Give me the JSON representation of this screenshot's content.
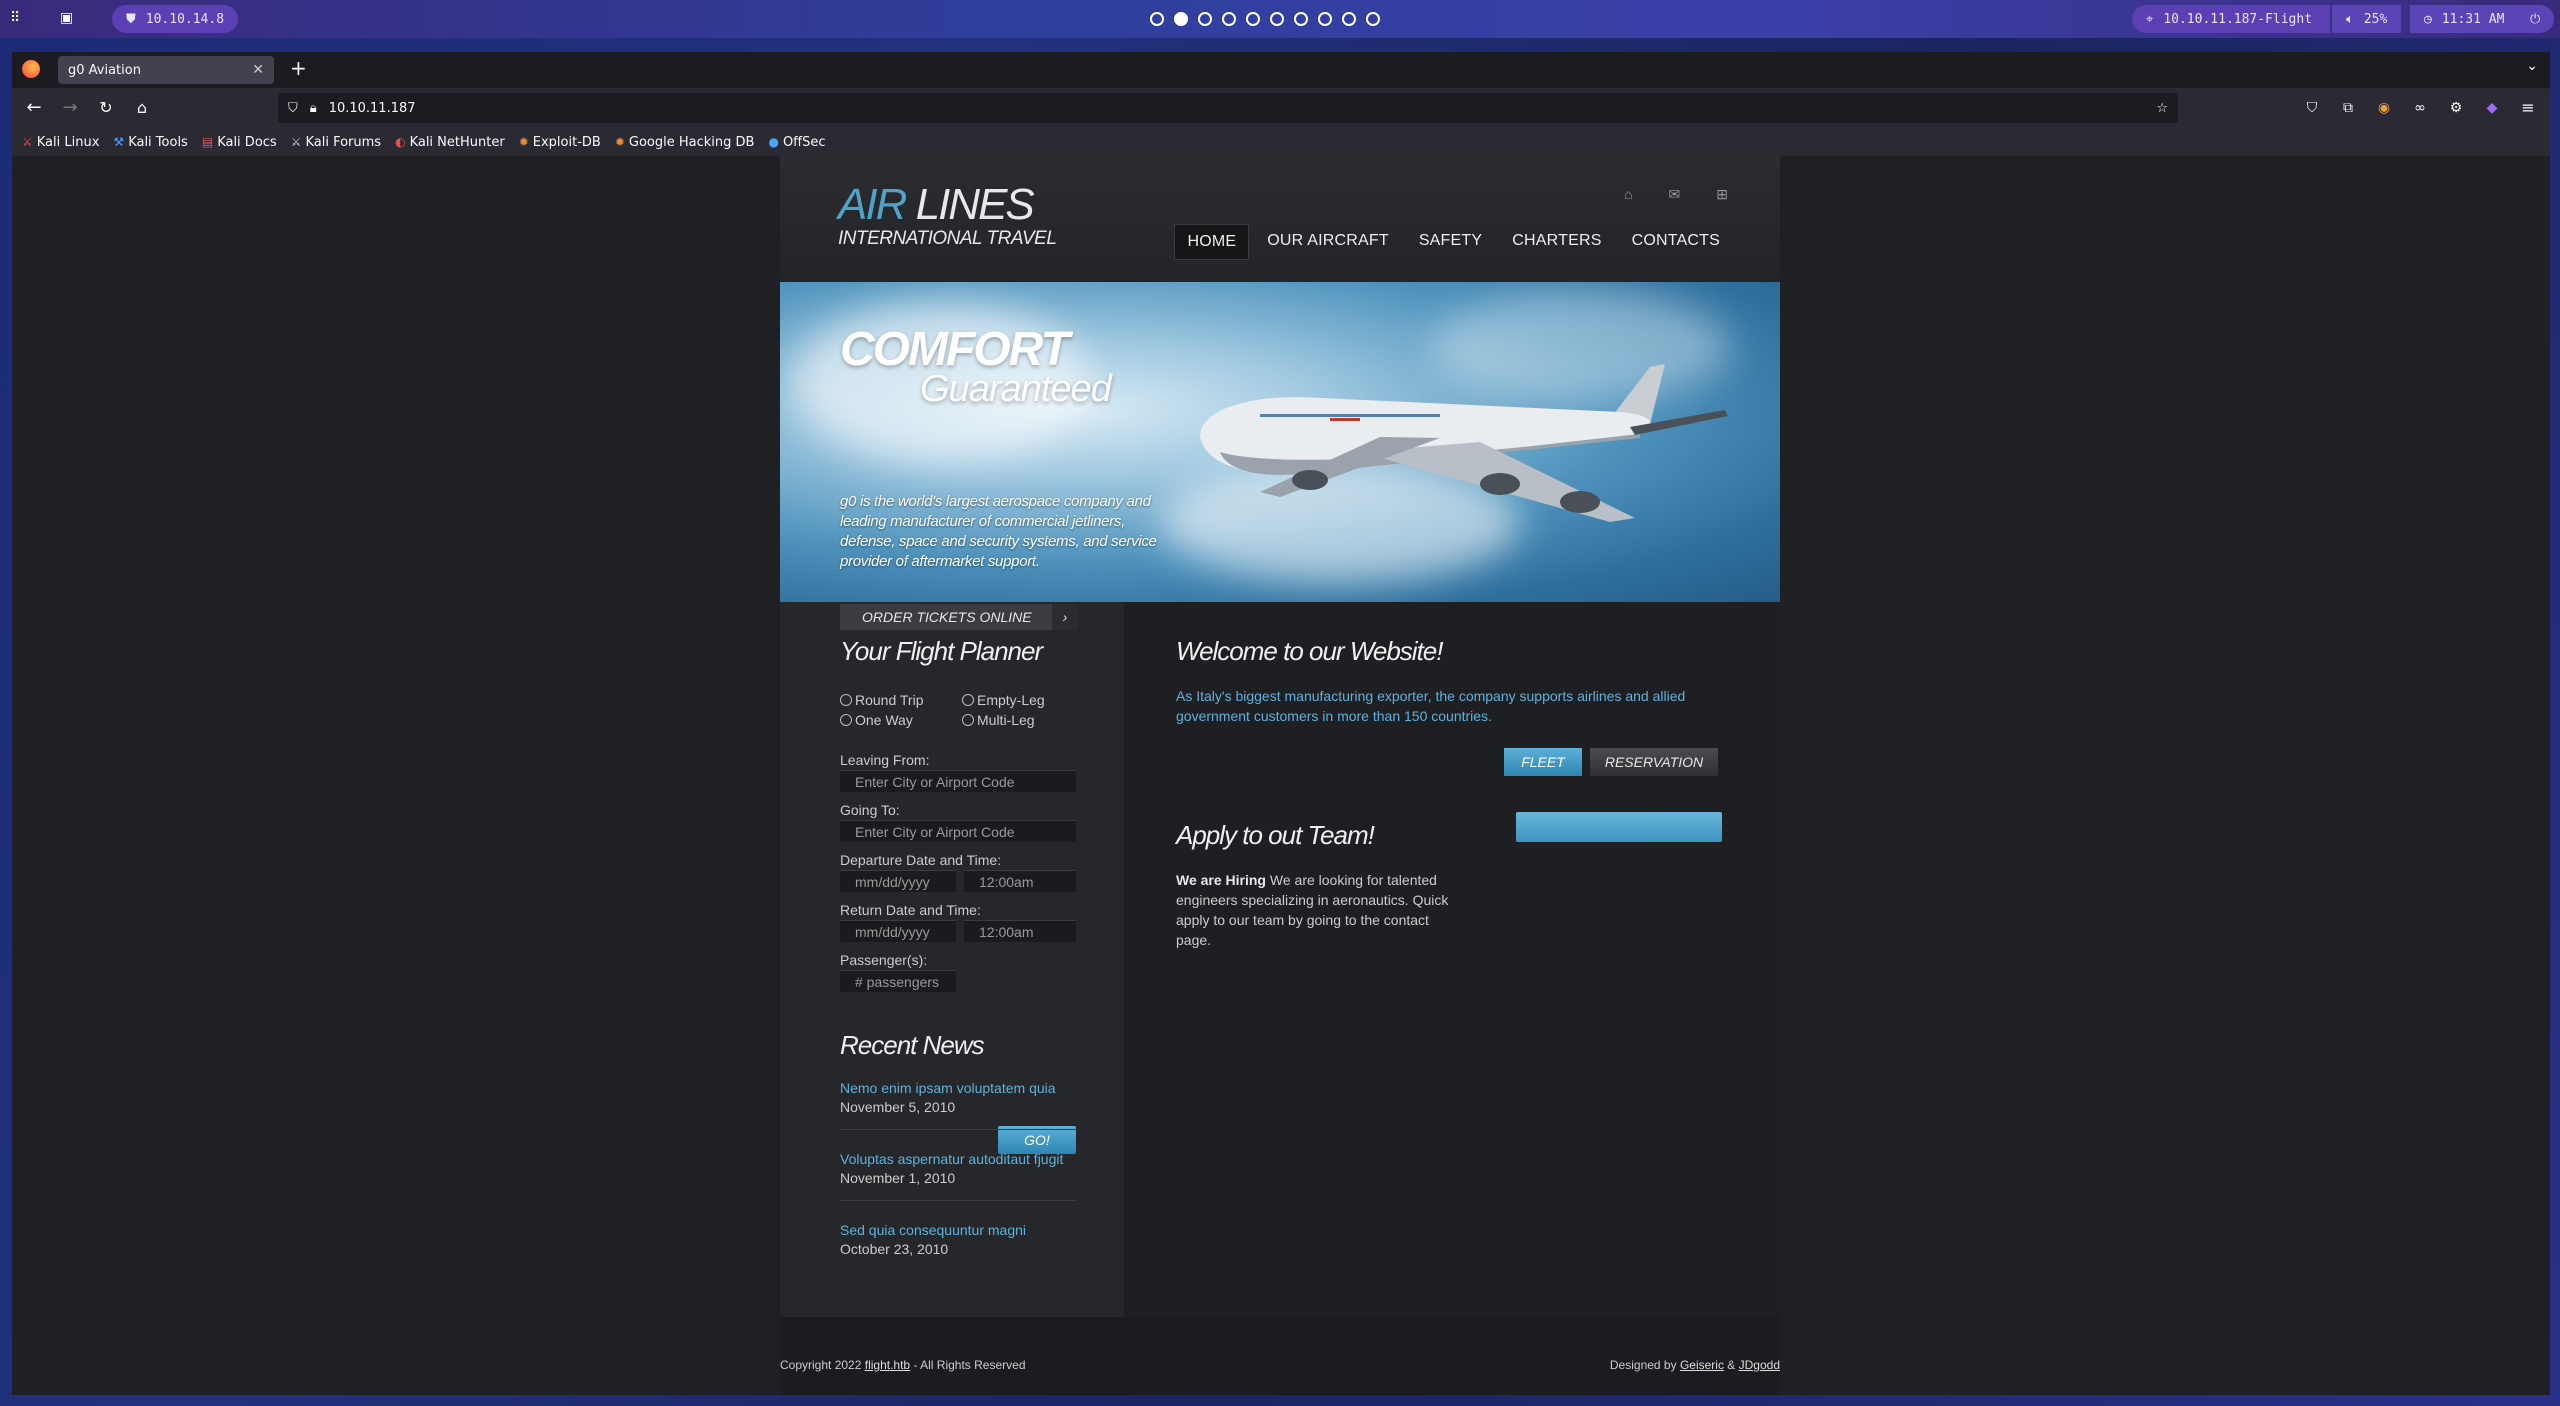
{
  "desktop": {
    "left_pill": "10.10.14.8",
    "right_pill_host": "10.10.11.187-Flight",
    "volume": "25%",
    "clock": "11:31 AM"
  },
  "browser": {
    "tab_title": "g0 Aviation",
    "url": "10.10.11.187",
    "bookmarks": [
      "Kali Linux",
      "Kali Tools",
      "Kali Docs",
      "Kali Forums",
      "Kali NetHunter",
      "Exploit-DB",
      "Google Hacking DB",
      "OffSec"
    ]
  },
  "site": {
    "logo_air": "AIR",
    "logo_lines": "LINES",
    "logo_sub": "INTERNATIONAL TRAVEL",
    "menu": [
      "HOME",
      "OUR AIRCRAFT",
      "SAFETY",
      "CHARTERS",
      "CONTACTS"
    ],
    "hero": {
      "title1": "COMFORT",
      "title2": "Guaranteed",
      "desc": "g0 is the world's largest aerospace company and leading manufacturer of commercial jetliners, defense, space and security systems, and service provider of aftermarket support."
    },
    "order_label": "ORDER TICKETS ONLINE",
    "planner": {
      "title": "Your Flight Planner",
      "trip_types": [
        "Round Trip",
        "Empty-Leg",
        "One Way",
        "Multi-Leg"
      ],
      "leaving_label": "Leaving From:",
      "leaving_placeholder": "Enter City or Airport Code",
      "going_label": "Going To:",
      "going_placeholder": "Enter City or Airport Code",
      "departure_label": "Departure Date and Time:",
      "return_label": "Return Date and Time:",
      "date_placeholder": "mm/dd/yyyy",
      "time_placeholder": "12:00am",
      "passengers_label": "Passenger(s):",
      "passengers_placeholder": "# passengers",
      "go_label": "GO!"
    },
    "news": {
      "title": "Recent News",
      "items": [
        {
          "title": "Nemo enim ipsam voluptatem quia",
          "date": "November 5, 2010"
        },
        {
          "title": "Voluptas aspernatur autoditaut fjugit",
          "date": "November 1, 2010"
        },
        {
          "title": "Sed quia consequuntur magni",
          "date": "October 23, 2010"
        }
      ]
    },
    "welcome": {
      "title": "Welcome to our Website!",
      "text": "As Italy's biggest manufacturing exporter, the company supports airlines and allied government customers in more than 150 countries.",
      "fleet": "FLEET",
      "reservation": "RESERVATION"
    },
    "apply": {
      "title": "Apply to out Team!",
      "bold": "We are Hiring",
      "text": " We are looking for talented engineers specializing in aeronautics. Quick apply to our team by going to the contact page."
    },
    "footer": {
      "copy_pre": "Copyright 2022 ",
      "copy_link": "flight.htb",
      "copy_post": " - All Rights Reserved",
      "design_pre": "Designed by ",
      "d1": "Geiseric",
      "amp": " & ",
      "d2": "JDgodd"
    }
  }
}
